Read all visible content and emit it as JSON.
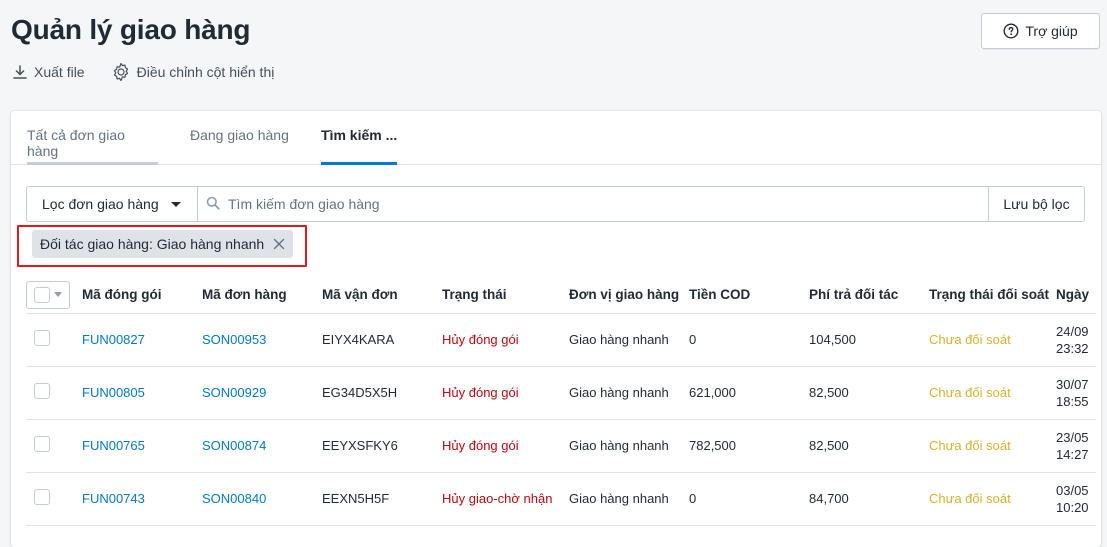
{
  "page": {
    "title": "Quản lý giao hàng",
    "help_label": "Trợ giúp"
  },
  "actions": {
    "export_label": "Xuất file",
    "columns_label": "Điều chỉnh cột hiển thị"
  },
  "tabs": [
    {
      "label": "Tất cả đơn giao hàng"
    },
    {
      "label": "Đang giao hàng"
    },
    {
      "label": "Tìm kiếm ..."
    }
  ],
  "filter": {
    "dropdown_label": "Lọc đơn giao hàng",
    "search_placeholder": "Tìm kiếm đơn giao hàng",
    "save_label": "Lưu bộ lọc",
    "active_tag": "Đối tác giao hàng: Giao hàng nhanh"
  },
  "table": {
    "columns": [
      "Mã đóng gói",
      "Mã đơn hàng",
      "Mã vận đơn",
      "Trạng thái",
      "Đơn vị giao hàng",
      "Tiền COD",
      "Phí trả đối tác",
      "Trạng thái đối soát",
      "Ngày"
    ],
    "rows": [
      {
        "pack": "FUN00827",
        "order": "SON00953",
        "tracking": "EIYX4KARA",
        "status": "Hủy đóng gói",
        "carrier": "Giao hàng nhanh",
        "cod": "0",
        "fee": "104,500",
        "recon": "Chưa đối soát",
        "date1": "24/09",
        "date2": "23:32"
      },
      {
        "pack": "FUN00805",
        "order": "SON00929",
        "tracking": "EG34D5X5H",
        "status": "Hủy đóng gói",
        "carrier": "Giao hàng nhanh",
        "cod": "621,000",
        "fee": "82,500",
        "recon": "Chưa đối soát",
        "date1": "30/07",
        "date2": "18:55"
      },
      {
        "pack": "FUN00765",
        "order": "SON00874",
        "tracking": "EEYXSFKY6",
        "status": "Hủy đóng gói",
        "carrier": "Giao hàng nhanh",
        "cod": "782,500",
        "fee": "82,500",
        "recon": "Chưa đối soát",
        "date1": "23/05",
        "date2": "14:27"
      },
      {
        "pack": "FUN00743",
        "order": "SON00840",
        "tracking": "EEXN5H5F",
        "status": "Hủy giao-chờ nhận",
        "carrier": "Giao hàng nhanh",
        "cod": "0",
        "fee": "84,700",
        "recon": "Chưa đối soát",
        "date1": "03/05",
        "date2": "10:20"
      }
    ]
  },
  "colors": {
    "link": "#007ace",
    "status_cancel": "#bf0711",
    "recon_pending": "#d5b331",
    "highlight": "#e01b1b"
  }
}
